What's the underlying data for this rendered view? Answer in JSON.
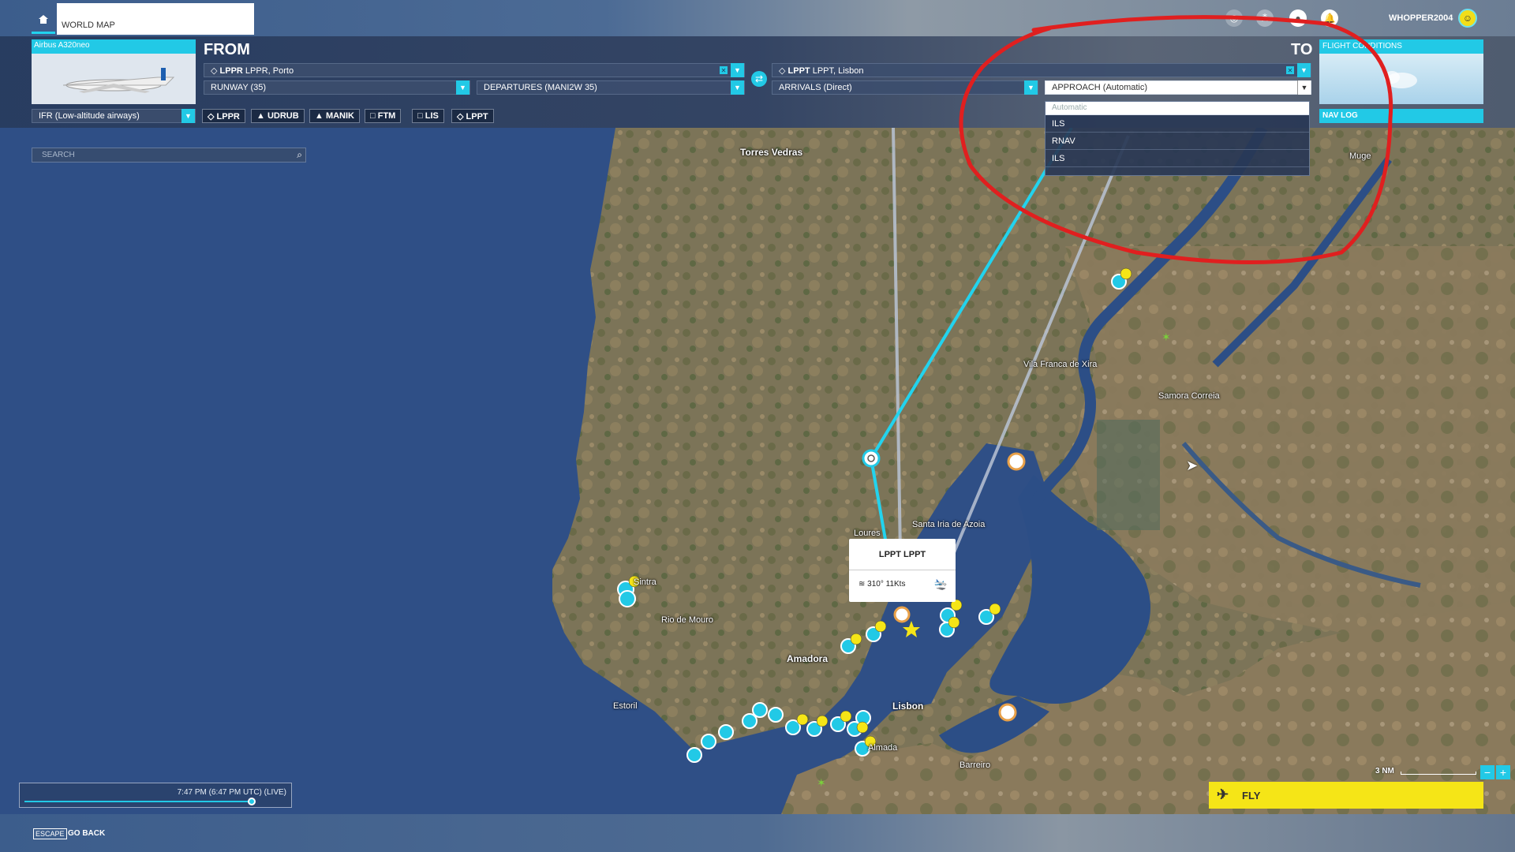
{
  "topbar": {
    "world_map_tab": "WORLD MAP",
    "username": "WHOPPER2004",
    "icons": [
      "home-icon",
      "help-icon",
      "community-icon",
      "profile-icon",
      "notifications-icon"
    ]
  },
  "aircraft": {
    "name": "Airbus A320neo"
  },
  "from": {
    "label": "FROM",
    "airport_code": "LPPR",
    "airport_name": "LPPR, Porto",
    "runway": "RUNWAY (35)",
    "departure": "DEPARTURES (MANI2W 35)"
  },
  "to": {
    "label": "TO",
    "airport_code": "LPPT",
    "airport_name": "LPPT, Lisbon",
    "arrival": "ARRIVALS (Direct)",
    "approach": "APPROACH (Automatic)"
  },
  "approach_options": [
    "Automatic",
    "ILS",
    "RNAV",
    "ILS"
  ],
  "flight_conditions": {
    "label": "FLIGHT CONDITIONS"
  },
  "flight_plan": {
    "type": "IFR (Low-altitude airways)",
    "waypoints": [
      {
        "symbol": "◇",
        "name": "LPPR"
      },
      {
        "symbol": "▲",
        "name": "UDRUB"
      },
      {
        "symbol": "▲",
        "name": "MANIK"
      },
      {
        "symbol": "□",
        "name": "FTM"
      },
      {
        "symbol": "□",
        "name": "LIS"
      },
      {
        "symbol": "◇",
        "name": "LPPT"
      }
    ]
  },
  "nav_log": {
    "label": "NAV LOG"
  },
  "search": {
    "placeholder": "SEARCH"
  },
  "map_labels": {
    "torres_vedras": "Torres Vedras",
    "vila_franca": "Vila Franca de Xira",
    "samora": "Samora Correia",
    "loures": "Loures",
    "santa_iria": "Santa Iria de Azoia",
    "rio_de_mouro": "Rio de Mouro",
    "amadora": "Amadora",
    "estoril": "Estoril",
    "lisbon": "Lisbon",
    "almada": "Almada",
    "barreiro": "Barreiro",
    "muge": "Muge",
    "sintra": "Sintra"
  },
  "airport_popup": {
    "title": "LPPT LPPT",
    "wind": "310° 11Kts"
  },
  "time": {
    "display": "7:47 PM (6:47 PM UTC) (LIVE)",
    "slider_fraction": 0.97
  },
  "scale": {
    "label": "3 NM"
  },
  "fly_button": {
    "label": "FLY"
  },
  "footer": {
    "escape_key": "ESCAPE",
    "go_back": "GO BACK"
  },
  "colors": {
    "accent": "#22c9e6",
    "fly": "#f5e517",
    "annotation": "#e01f1f",
    "sea": "#2f4f86"
  }
}
